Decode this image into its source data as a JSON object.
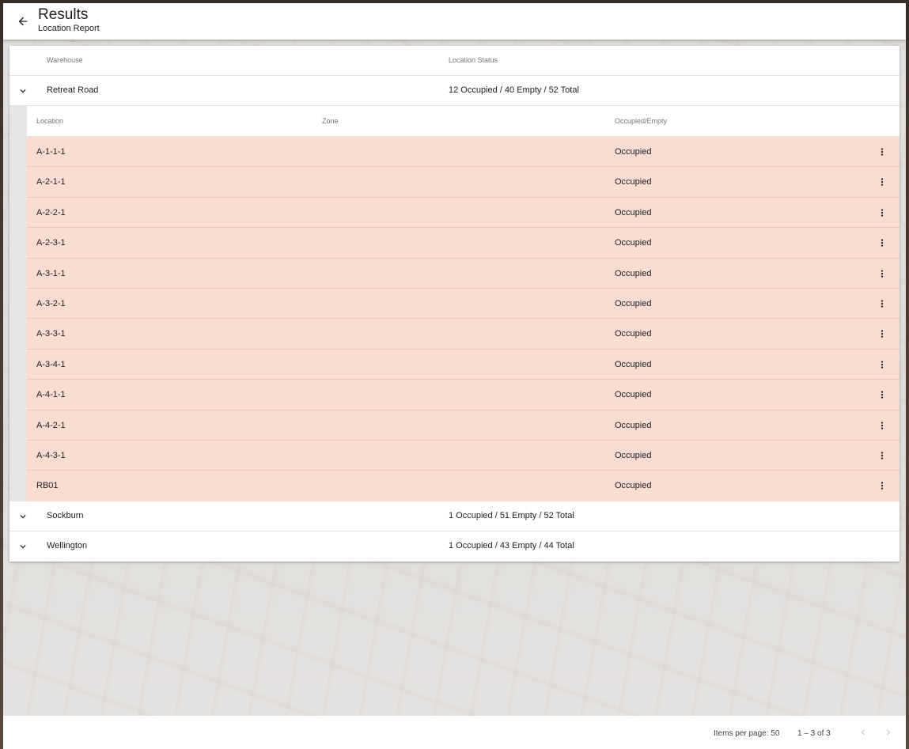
{
  "header": {
    "title": "Results",
    "subtitle": "Location Report"
  },
  "table": {
    "columns": {
      "warehouse": "Warehouse",
      "status": "Location Status"
    },
    "warehouses": [
      {
        "name": "Retreat Road",
        "status": "12 Occupied / 40 Empty / 52 Total",
        "expanded": true
      },
      {
        "name": "Sockburn",
        "status": "1 Occupied / 51 Empty / 52 Total",
        "expanded": false
      },
      {
        "name": "Wellington",
        "status": "1 Occupied / 43 Empty / 44 Total",
        "expanded": false
      }
    ],
    "detail": {
      "columns": {
        "location": "Location",
        "zone": "Zone",
        "occupied": "Occupied/Empty"
      },
      "rows": [
        {
          "location": "A-1-1-1",
          "zone": "",
          "occupied": "Occupied"
        },
        {
          "location": "A-2-1-1",
          "zone": "",
          "occupied": "Occupied"
        },
        {
          "location": "A-2-2-1",
          "zone": "",
          "occupied": "Occupied"
        },
        {
          "location": "A-2-3-1",
          "zone": "",
          "occupied": "Occupied"
        },
        {
          "location": "A-3-1-1",
          "zone": "",
          "occupied": "Occupied"
        },
        {
          "location": "A-3-2-1",
          "zone": "",
          "occupied": "Occupied"
        },
        {
          "location": "A-3-3-1",
          "zone": "",
          "occupied": "Occupied"
        },
        {
          "location": "A-3-4-1",
          "zone": "",
          "occupied": "Occupied"
        },
        {
          "location": "A-4-1-1",
          "zone": "",
          "occupied": "Occupied"
        },
        {
          "location": "A-4-2-1",
          "zone": "",
          "occupied": "Occupied"
        },
        {
          "location": "A-4-3-1",
          "zone": "",
          "occupied": "Occupied"
        },
        {
          "location": "RB01",
          "zone": "",
          "occupied": "Occupied"
        }
      ]
    }
  },
  "paginator": {
    "items_per_page": "Items per page: 50",
    "range": "1 – 3 of 3"
  },
  "icons": {
    "back": "arrow-back-icon",
    "expand": "chevron-down-icon",
    "row_menu": "more-vert-icon",
    "prev": "chevron-left-icon",
    "next": "chevron-right-icon"
  },
  "colors": {
    "occupied_row": "#fadcd2"
  }
}
